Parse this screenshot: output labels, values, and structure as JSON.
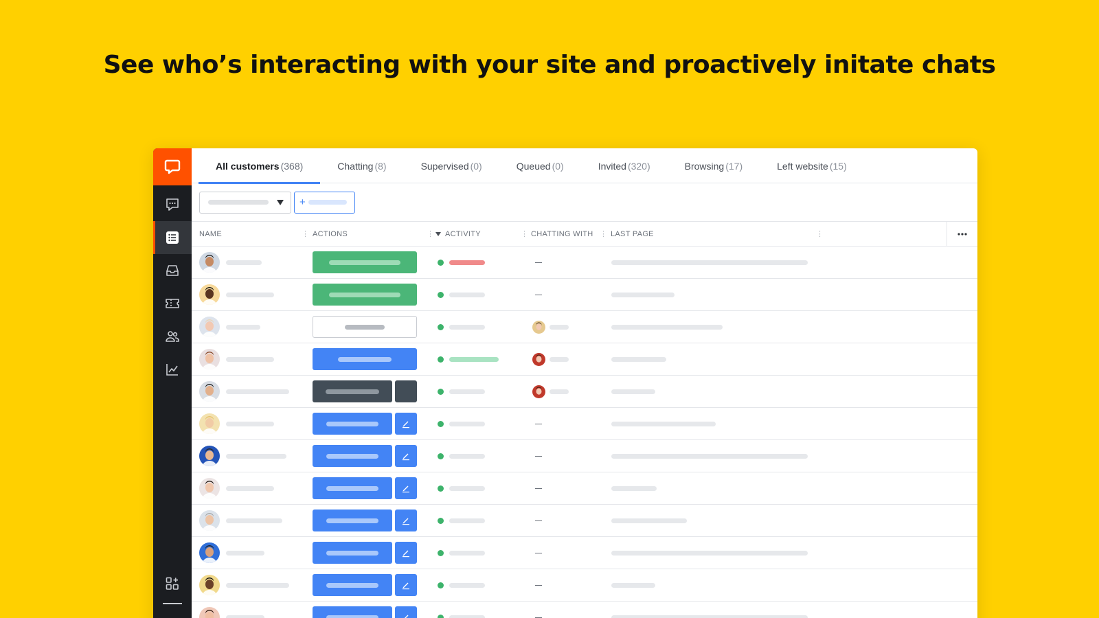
{
  "headline": "See who’s interacting with your site and proactively initate chats",
  "tabs": [
    {
      "label": "All customers",
      "count": "(368)",
      "active": true
    },
    {
      "label": "Chatting",
      "count": "(8)"
    },
    {
      "label": "Supervised",
      "count": "(0)"
    },
    {
      "label": "Queued",
      "count": "(0)"
    },
    {
      "label": "Invited",
      "count": "(320)"
    },
    {
      "label": "Browsing",
      "count": "(17)"
    },
    {
      "label": "Left website",
      "count": "(15)"
    }
  ],
  "filters": {
    "add_symbol": "+"
  },
  "columns": {
    "name": "NAME",
    "actions": "ACTIONS",
    "activity": "ACTIVITY",
    "chatting_with": "CHATTING WITH",
    "last_page": "LAST PAGE"
  },
  "sidebar": {
    "items": [
      {
        "icon": "chat-bubble-icon"
      },
      {
        "icon": "customers-list-icon",
        "active": true
      },
      {
        "icon": "inbox-icon"
      },
      {
        "icon": "ticket-icon"
      },
      {
        "icon": "team-icon"
      },
      {
        "icon": "reports-icon"
      }
    ],
    "bottom": [
      {
        "icon": "apps-icon"
      }
    ]
  },
  "colors": {
    "background": "#FFD000",
    "brand": "#FF5100",
    "sidebar": "#1b1d21",
    "primary_button": "#4384f5",
    "start_chat_button": "#4bb678",
    "supervise_button": "#424d57",
    "status_online": "#3db36b"
  },
  "rows": [
    {
      "action": "green",
      "activity_bar": "red",
      "chatting": "none"
    },
    {
      "action": "green",
      "activity_bar": "grey",
      "chatting": "none"
    },
    {
      "action": "outline",
      "activity_bar": "grey",
      "chatting": "agent"
    },
    {
      "action": "blue",
      "activity_bar": "mint",
      "chatting": "agent"
    },
    {
      "action": "dark",
      "activity_bar": "grey",
      "chatting": "agent"
    },
    {
      "action": "blue-edit",
      "activity_bar": "grey",
      "chatting": "none"
    },
    {
      "action": "blue-edit",
      "activity_bar": "grey",
      "chatting": "none"
    },
    {
      "action": "blue-edit",
      "activity_bar": "grey",
      "chatting": "none"
    },
    {
      "action": "blue-edit",
      "activity_bar": "grey",
      "chatting": "none"
    },
    {
      "action": "blue-edit",
      "activity_bar": "grey",
      "chatting": "none"
    },
    {
      "action": "blue-edit",
      "activity_bar": "grey",
      "chatting": "none"
    },
    {
      "action": "blue-edit",
      "activity_bar": "grey",
      "chatting": "none"
    }
  ]
}
